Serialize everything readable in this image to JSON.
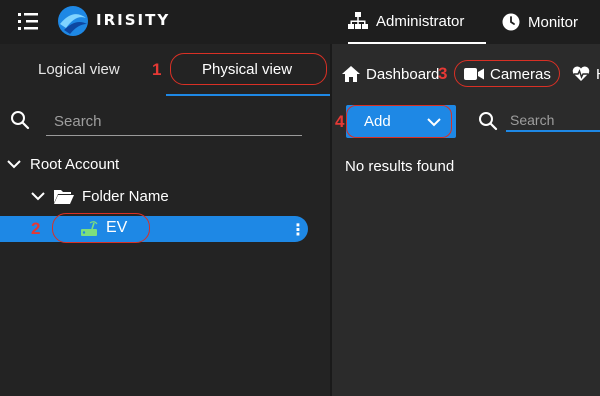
{
  "brand": {
    "name": "IRISITY"
  },
  "topnav": {
    "admin_label": "Administrator",
    "monitor_label": "Monitor"
  },
  "view_tabs": {
    "logical": "Logical view",
    "physical": "Physical view"
  },
  "left_search": {
    "placeholder": "Search"
  },
  "tree": {
    "root": "Root Account",
    "folder": "Folder Name",
    "device": "EV"
  },
  "right_tabs": {
    "dashboard": "Dashboard",
    "cameras": "Cameras",
    "health": "H"
  },
  "toolbar": {
    "add_label": "Add",
    "search_placeholder": "Search"
  },
  "results": {
    "empty_text": "No results found"
  },
  "annotations": [
    "1",
    "2",
    "3",
    "4"
  ],
  "colors": {
    "accent": "#1e88e5",
    "annotation": "#d93025",
    "topbar": "#1e1e1e",
    "panel": "#232323",
    "background": "#2b2b2b"
  }
}
